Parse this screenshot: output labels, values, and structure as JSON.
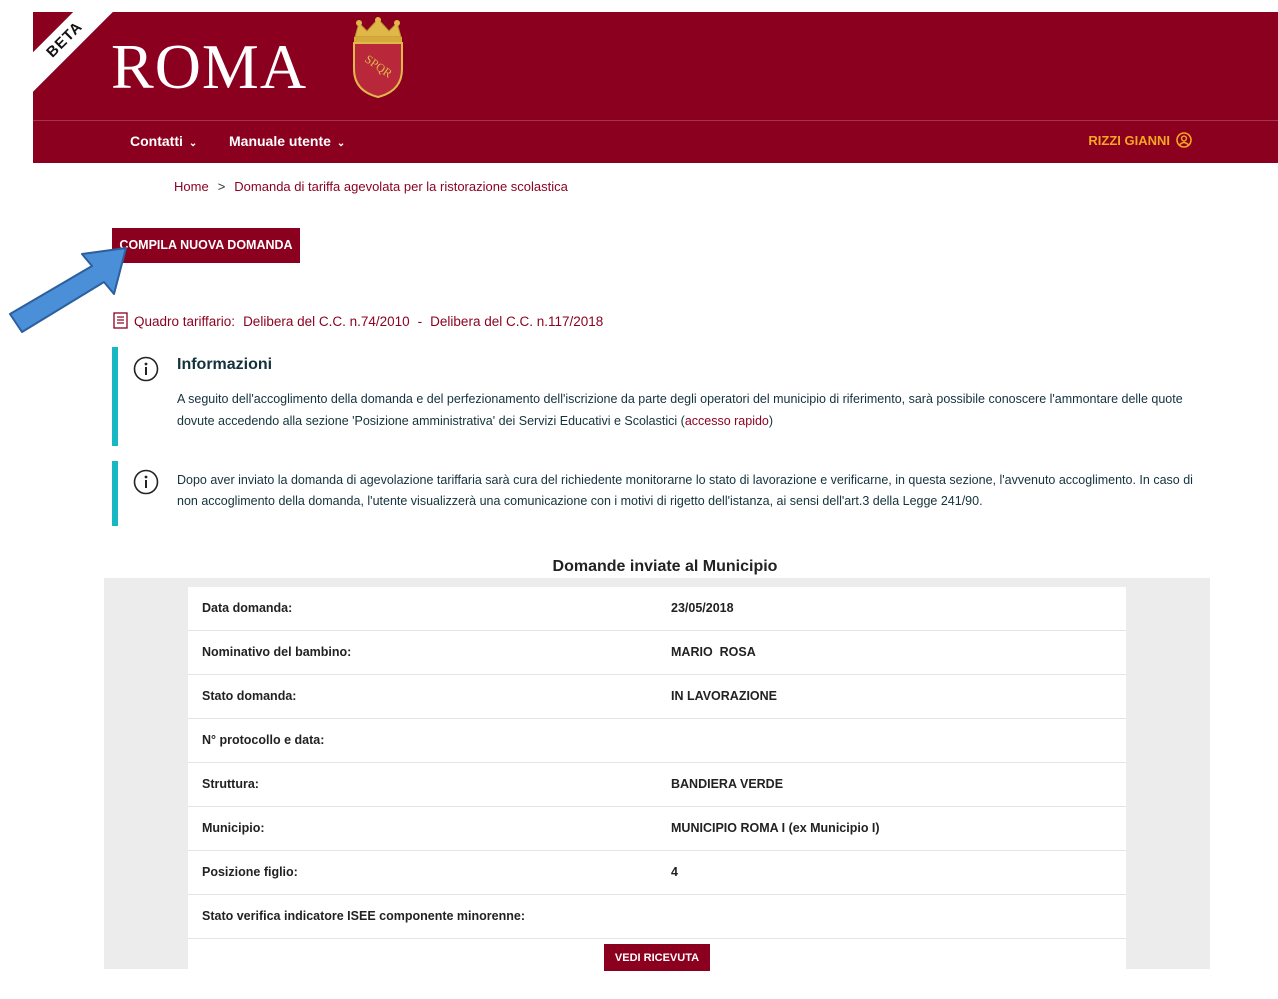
{
  "header": {
    "beta_label": "BETA",
    "logo_text": "ROMA",
    "emblem_text": "SPQR",
    "nav": [
      {
        "label": "Contatti"
      },
      {
        "label": "Manuale utente"
      }
    ],
    "user_name": "RIZZI GIANNI"
  },
  "breadcrumb": {
    "home": "Home",
    "separator": ">",
    "current": "Domanda di tariffa agevolata per la ristorazione scolastica"
  },
  "new_request_button": "COMPILA NUOVA DOMANDA",
  "tariff": {
    "label": "Quadro tariffario:",
    "link1": "Delibera del C.C. n.74/2010",
    "separator": "-",
    "link2": "Delibera del C.C. n.117/2018"
  },
  "info1": {
    "title": "Informazioni",
    "text_before": "A seguito dell'accoglimento della domanda e del perfezionamento dell'iscrizione da parte degli operatori del municipio di riferimento, sarà possibile conoscere l'ammontare delle quote dovute accedendo alla sezione 'Posizione amministrativa' dei Servizi Educativi e Scolastici (",
    "link": "accesso rapido",
    "text_after": ")"
  },
  "info2": {
    "text": "Dopo aver inviato la domanda di agevolazione tariffaria sarà cura del richiedente monitorarne lo stato di lavorazione e verificarne, in questa sezione, l'avvenuto accoglimento. In caso di non accoglimento della domanda, l'utente visualizzerà una comunicazione con i motivi di rigetto dell'istanza, ai sensi dell'art.3 della Legge 241/90."
  },
  "requests": {
    "title": "Domande inviate al Municipio",
    "rows": [
      {
        "label": "Data domanda:",
        "value": "23/05/2018"
      },
      {
        "label": "Nominativo del bambino:",
        "value": "MARIO  ROSA"
      },
      {
        "label": "Stato domanda:",
        "value": "IN LAVORAZIONE"
      },
      {
        "label": "N° protocollo e data:",
        "value": ""
      },
      {
        "label": "Struttura:",
        "value": "BANDIERA VERDE"
      },
      {
        "label": "Municipio:",
        "value": "MUNICIPIO ROMA I (ex Municipio I)"
      },
      {
        "label": "Posizione figlio:",
        "value": "4"
      },
      {
        "label": "Stato verifica indicatore ISEE componente minorenne:",
        "value": ""
      }
    ],
    "receipt_button": "VEDI RICEVUTA"
  },
  "colors": {
    "brand": "#8b001f",
    "accent_bar": "#17b8c4",
    "user_highlight": "#f5a623",
    "arrow": "#4a8fd8"
  }
}
